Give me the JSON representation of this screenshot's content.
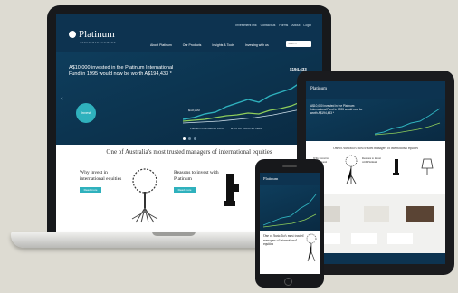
{
  "site": {
    "logo": "Platinum",
    "logo_sub": "ASSET MANAGEMENT",
    "util_links": [
      "Investment link",
      "Contact us",
      "Forms",
      "About",
      "Login"
    ],
    "menu": [
      "About Platinum",
      "Our Products",
      "Insights & Tools",
      "Investing with us"
    ],
    "search_placeholder": "Search",
    "hero_text": "A$10,000 invested in the Platinum International Fund in 1995 would now be worth A$194,433 *",
    "hero_button": "Invest",
    "chart": {
      "end_value": "$194,433",
      "start_value": "$10,000",
      "legend": [
        "Platinum International Fund",
        "MSCI AC World Net Index"
      ]
    },
    "tagline": "One of Australia's most trusted managers of international equities",
    "cards": [
      {
        "title": "Why invest in international equities",
        "button": "Read more"
      },
      {
        "title": "Reasons to invest with Platinum",
        "button": "Read more"
      }
    ]
  },
  "tablet": {
    "tagline": "One of Australia's most trusted managers of international equities"
  },
  "phone": {
    "text": "One of Australia's most trusted managers of international equities"
  }
}
